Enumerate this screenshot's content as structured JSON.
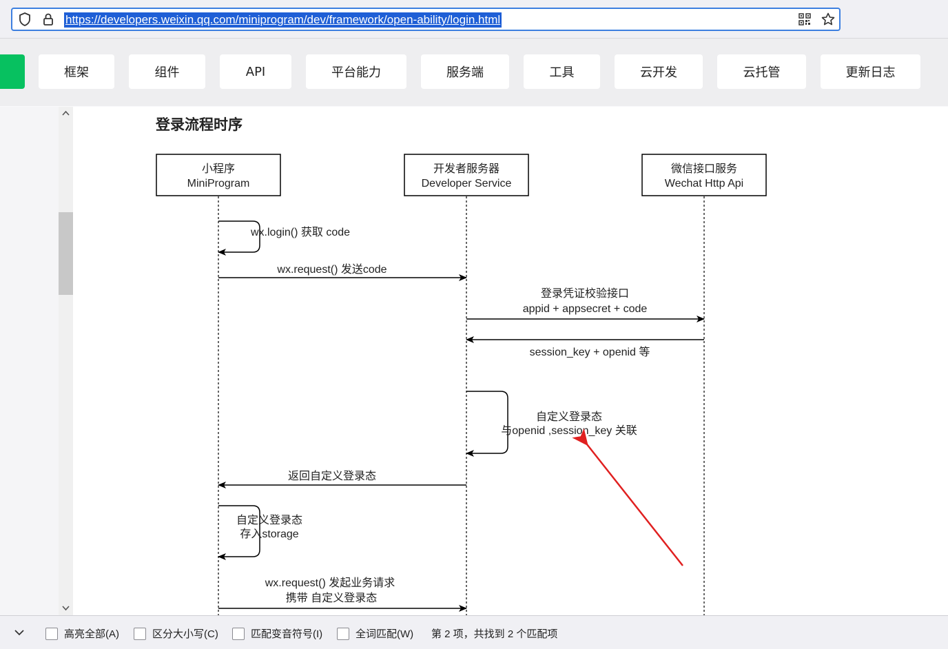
{
  "browser": {
    "url": "https://developers.weixin.qq.com/miniprogram/dev/framework/open-ability/login.html",
    "icons": [
      "shield-icon",
      "lock-icon",
      "qr-code-icon",
      "bookmark-star-icon"
    ]
  },
  "nav": {
    "tabs": [
      "框架",
      "组件",
      "API",
      "平台能力",
      "服务端",
      "工具",
      "云开发",
      "云托管",
      "更新日志"
    ],
    "accent": "#07c160"
  },
  "page": {
    "heading": "登录流程时序"
  },
  "diagram": {
    "actors": [
      {
        "line1": "小程序",
        "line2": "MiniProgram"
      },
      {
        "line1": "开发者服务器",
        "line2": "Developer Service"
      },
      {
        "line1": "微信接口服务",
        "line2": "Wechat Http Api"
      }
    ],
    "messages": {
      "m1": "wx.login() 获取 code",
      "m2": "wx.request() 发送code",
      "m3a": "登录凭证校验接口",
      "m3b": "appid + appsecret + code",
      "m4": "session_key + openid 等",
      "m5a": "自定义登录态",
      "m5b": "与openid ,session_key 关联",
      "m6": "返回自定义登录态",
      "m7a": "自定义登录态",
      "m7b": "存入storage",
      "m8a": "wx.request() 发起业务请求",
      "m8b": "携带 自定义登录态"
    },
    "annotation_color": "#e02020"
  },
  "findbar": {
    "options": [
      "高亮全部(A)",
      "区分大小写(C)",
      "匹配变音符号(I)",
      "全词匹配(W)"
    ],
    "status": "第 2 项，共找到 2 个匹配项"
  }
}
